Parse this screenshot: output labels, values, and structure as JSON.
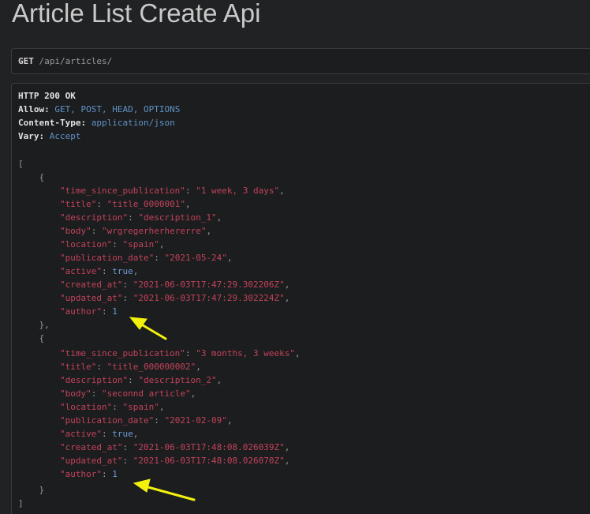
{
  "page": {
    "title": "Article List Create Api"
  },
  "request": {
    "method": "GET",
    "path": " /api/articles/"
  },
  "response": {
    "status_line": "HTTP 200 OK",
    "headers": [
      {
        "key": "Allow",
        "value": "GET, POST, HEAD, OPTIONS"
      },
      {
        "key": "Content-Type",
        "value": "application/json"
      },
      {
        "key": "Vary",
        "value": "Accept"
      }
    ],
    "articles": [
      {
        "time_since_publication": "1 week, 3 days",
        "title": "title_0000001",
        "description": "description_1",
        "body": "wrgregerherhererre",
        "location": "spain",
        "publication_date": "2021-05-24",
        "active": "true",
        "created_at": "2021-06-03T17:47:29.302206Z",
        "updated_at": "2021-06-03T17:47:29.302224Z",
        "author": "1"
      },
      {
        "time_since_publication": "3 months, 3 weeks",
        "title": "title_000000002",
        "description": "description_2",
        "body": "seconnd article",
        "location": "spain",
        "publication_date": "2021-02-09",
        "active": "true",
        "created_at": "2021-06-03T17:48:08.026039Z",
        "updated_at": "2021-06-03T17:48:08.026070Z",
        "author": "1"
      }
    ]
  },
  "colors": {
    "background": "#212224",
    "json_string": "#c2435a",
    "json_literal": "#6f9bd1",
    "header_value": "#5f93c7",
    "annotation_arrow": "#f2f20d"
  }
}
